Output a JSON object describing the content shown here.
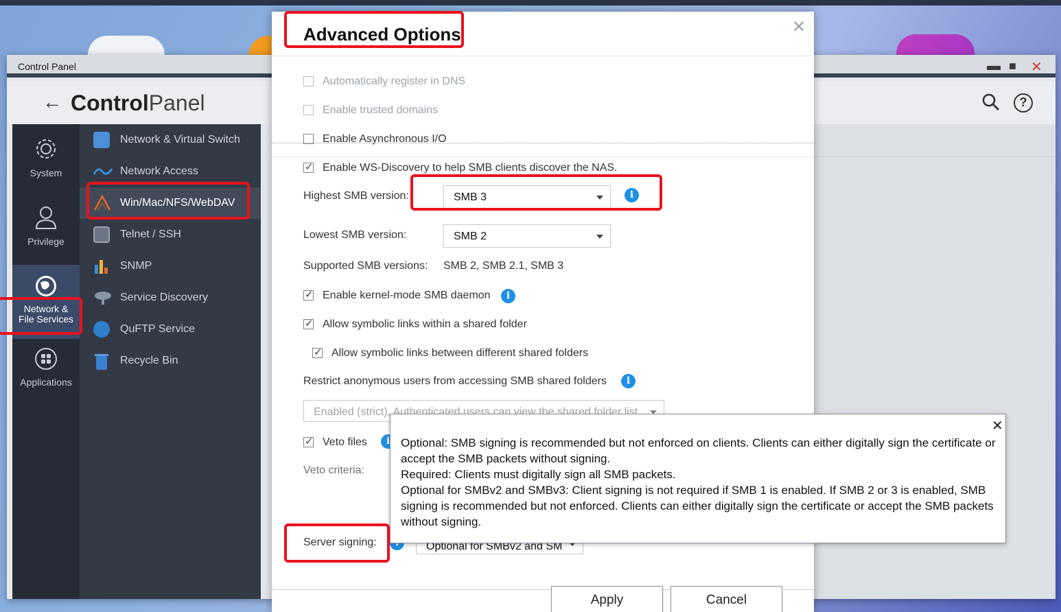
{
  "window": {
    "title": "Control Panel",
    "header_title_bold": "Control",
    "header_title_light": "Panel"
  },
  "categories": {
    "system": "System",
    "privilege": "Privilege",
    "network_line1": "Network &",
    "network_line2": "File Services",
    "applications": "Applications"
  },
  "submenu": {
    "items": [
      {
        "label": "Network & Virtual Switch",
        "color": "#4a90d9"
      },
      {
        "label": "Network Access",
        "color": "#3b8fd6"
      },
      {
        "label": "Win/Mac/NFS/WebDAV",
        "color": "#e06a2a"
      },
      {
        "label": "Telnet / SSH",
        "color": "#6d7684"
      },
      {
        "label": "SNMP",
        "color": "#f2b43a"
      },
      {
        "label": "Service Discovery",
        "color": "#8a96a6"
      },
      {
        "label": "QuFTP Service",
        "color": "#2f7fcc"
      },
      {
        "label": "Recycle Bin",
        "color": "#3b7fd0"
      }
    ]
  },
  "dialog": {
    "title": "Advanced Options",
    "options": {
      "auto_dns": "Automatically register in DNS",
      "trusted_domains": "Enable trusted domains",
      "async_io": "Enable Asynchronous I/O",
      "ws_discovery": "Enable WS-Discovery to help SMB clients discover the NAS.",
      "highest_smb_label": "Highest SMB version:",
      "highest_smb_value": "SMB 3",
      "lowest_smb_label": "Lowest SMB version:",
      "lowest_smb_value": "SMB 2",
      "supported_label": "Supported SMB versions:",
      "supported_value": "SMB 2, SMB 2.1, SMB 3",
      "kernel_mode": "Enable kernel-mode SMB daemon",
      "symlinks_within": "Allow symbolic links within a shared folder",
      "symlinks_between": "Allow symbolic links between different shared folders",
      "restrict_anon": "Restrict anonymous users from accessing SMB shared folders",
      "restrict_anon_value": "Enabled (strict), Authenticated users can view the shared folder list",
      "veto_files": "Veto files",
      "veto_criteria": "Veto criteria:",
      "server_signing_label": "Server signing:",
      "server_signing_value": "Optional for SMBv2 and SM"
    },
    "buttons": {
      "apply": "Apply",
      "cancel": "Cancel"
    }
  },
  "tooltip": {
    "line1": "Optional: SMB signing is recommended but not enforced on clients. Clients can either digitally sign the certificate or accept the SMB packets without signing.",
    "line2": "Required: Clients must digitally sign all SMB packets.",
    "line3": "Optional for SMBv2 and SMBv3: Client signing is not required if SMB 1 is enabled. If SMB 2 or 3 is enabled, SMB signing is recommended but not enforced. Clients can either digitally sign the certificate or accept the SMB packets without signing."
  },
  "colors": {
    "highlight": "#e8121f",
    "info": "#1e90e6"
  }
}
